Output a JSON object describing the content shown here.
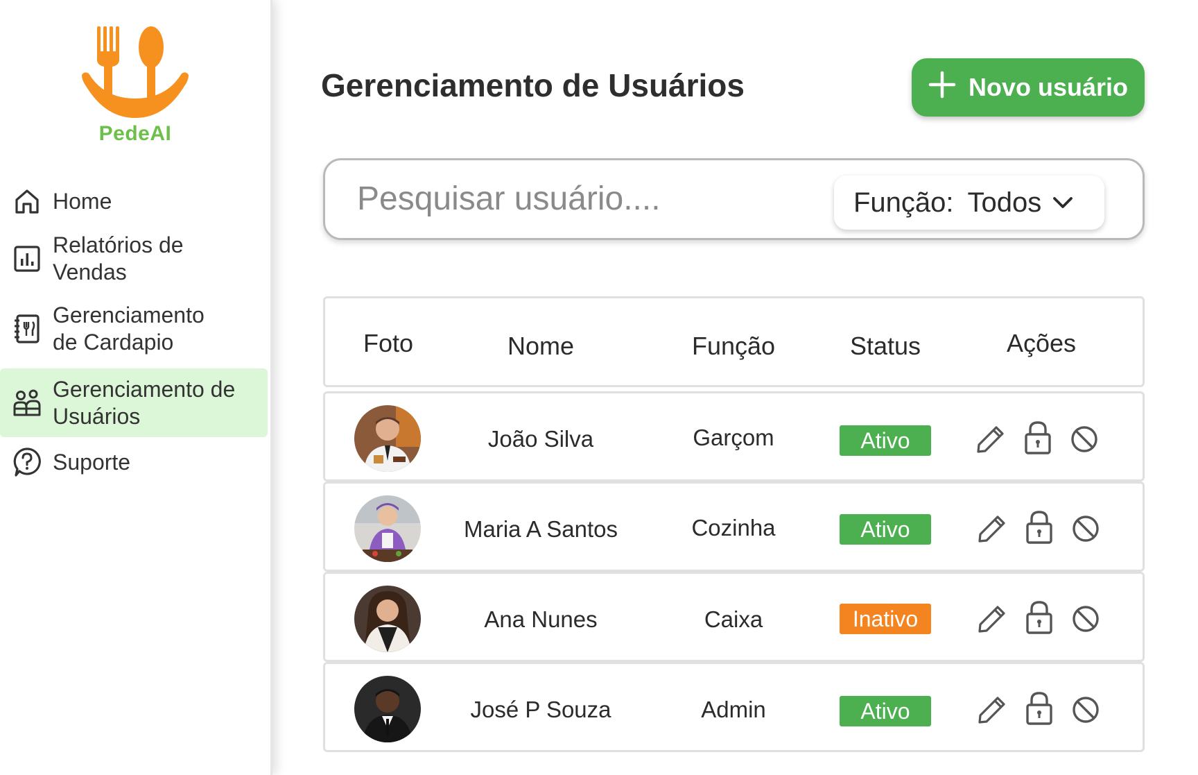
{
  "brand": {
    "name": "PedeAI",
    "colors": {
      "orange": "#f6901e",
      "green": "#6cc04a"
    }
  },
  "sidebar": {
    "items": [
      {
        "label_line1": "Home",
        "label_line2": "",
        "icon": "home-icon",
        "active": false
      },
      {
        "label_line1": "Relatórios de",
        "label_line2": "Vendas",
        "icon": "bar-chart-icon",
        "active": false
      },
      {
        "label_line1": "Gerenciamento",
        "label_line2": "de Cardapio",
        "icon": "menu-book-icon",
        "active": false
      },
      {
        "label_line1": "Gerenciamento de",
        "label_line2": "Usuários",
        "icon": "users-icon",
        "active": true
      },
      {
        "label_line1": "Suporte",
        "label_line2": "",
        "icon": "help-icon",
        "active": false
      }
    ]
  },
  "header": {
    "title": "Gerenciamento de Usuários",
    "new_user_label": "Novo usuário"
  },
  "search": {
    "placeholder": "Pesquisar usuário....",
    "filter_label": "Função:",
    "filter_value": "Todos"
  },
  "table": {
    "headers": {
      "foto": "Foto",
      "nome": "Nome",
      "funcao": "Função",
      "status": "Status",
      "acoes": "Ações"
    },
    "rows": [
      {
        "nome": "João Silva",
        "funcao": "Garçom",
        "status": "Ativo",
        "status_color": "#4caf50"
      },
      {
        "nome": "Maria A Santos",
        "funcao": "Cozinha",
        "status": "Ativo",
        "status_color": "#4caf50"
      },
      {
        "nome": "Ana Nunes",
        "funcao": "Caixa",
        "status": "Inativo",
        "status_color": "#f4841f"
      },
      {
        "nome": "José P Souza",
        "funcao": "Admin",
        "status": "Ativo",
        "status_color": "#4caf50"
      }
    ],
    "action_icons": [
      "edit-icon",
      "lock-icon",
      "block-icon"
    ]
  },
  "colors": {
    "primary": "#4caf50",
    "warning": "#f4841f",
    "active_nav_bg": "#dcf7d8"
  }
}
